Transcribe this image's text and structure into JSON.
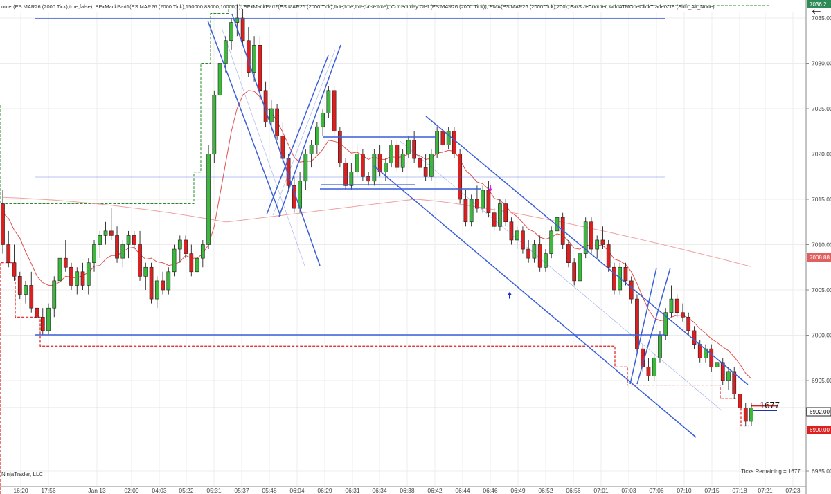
{
  "header": {
    "indicators": "unter(ES MAR26 (2000 Tick),true,false), BPxMackPart1(ES MAR26 (2000 Tick),150000,83000,10000,1), BPxMackPart2(ES MAR26 (2000 Tick),true,true,true,false,true), Current day OHL(ES MAR26 (2000 Tick)), EMA(ES MAR26 (2000 Tick),200), BarSizeCounter, wdoATMOneClickTraderV19 (Shift_Alt_None)"
  },
  "footer": {
    "copyright": "NinjaTrader, LLC",
    "ticks_remaining": "Ticks Remaining = 1677"
  },
  "counter": {
    "value": "1677"
  },
  "price_tags": {
    "top": "7036.2",
    "ema": "7008.88",
    "last": "6992.00",
    "low": "6990.00"
  },
  "colors": {
    "up": "#3cb83c",
    "down": "#dd1f1f",
    "channel": "#3a5fd8",
    "ema_fast": "#e05050",
    "ema_slow": "#f0a0a0",
    "level_red": "#dd1f1f",
    "level_green": "#2a8a2a"
  },
  "icons": {
    "back": "←"
  },
  "chart_data": {
    "type": "candlestick",
    "instrument": "ES MAR26 (2000 Tick)",
    "ylim": [
      6985.0,
      7037.0
    ],
    "y_ticks": [
      6985.0,
      6990.0,
      6995.0,
      7000.0,
      7005.0,
      7010.0,
      7015.0,
      7020.0,
      7025.0,
      7030.0,
      7035.0
    ],
    "x_labels": [
      "16:20",
      "17:56",
      "Jan 13",
      "02:09",
      "04:03",
      "05:22",
      "05:31",
      "05:37",
      "05:48",
      "06:04",
      "06:29",
      "06:31",
      "06:34",
      "06:38",
      "06:42",
      "06:44",
      "06:46",
      "06:49",
      "06:52",
      "06:56",
      "07:01",
      "07:03",
      "07:06",
      "07:10",
      "07:15",
      "07:18",
      "07:21",
      "07:23"
    ],
    "candles": [
      [
        7014.5,
        7016.0,
        7009.0,
        7010.0
      ],
      [
        7010.0,
        7011.5,
        7007.5,
        7008.0
      ],
      [
        7008.0,
        7010.0,
        7006.0,
        7006.5
      ],
      [
        7006.5,
        7007.0,
        7004.0,
        7004.5
      ],
      [
        7004.5,
        7006.0,
        7003.5,
        7005.5
      ],
      [
        7005.5,
        7007.0,
        7002.5,
        7003.0
      ],
      [
        7003.0,
        7004.0,
        7001.5,
        7002.0
      ],
      [
        7002.0,
        7003.0,
        7000.0,
        7000.5
      ],
      [
        7000.5,
        7003.5,
        7000.0,
        7003.0
      ],
      [
        7003.0,
        7006.5,
        7002.0,
        7006.0
      ],
      [
        7006.0,
        7009.0,
        7005.5,
        7008.5
      ],
      [
        7008.5,
        7010.5,
        7007.0,
        7007.5
      ],
      [
        7007.5,
        7008.0,
        7005.0,
        7005.5
      ],
      [
        7005.5,
        7007.5,
        7004.5,
        7007.0
      ],
      [
        7007.0,
        7008.0,
        7005.0,
        7005.5
      ],
      [
        7005.5,
        7008.5,
        7004.5,
        7008.0
      ],
      [
        7008.0,
        7010.5,
        7007.0,
        7010.0
      ],
      [
        7010.0,
        7011.5,
        7008.5,
        7011.0
      ],
      [
        7011.0,
        7012.5,
        7010.0,
        7011.5
      ],
      [
        7011.5,
        7014.0,
        7010.5,
        7011.0
      ],
      [
        7011.0,
        7012.0,
        7008.0,
        7008.5
      ],
      [
        7008.5,
        7010.5,
        7007.5,
        7010.0
      ],
      [
        7010.0,
        7011.5,
        7008.5,
        7011.0
      ],
      [
        7011.0,
        7011.5,
        7009.5,
        7010.0
      ],
      [
        7010.0,
        7011.5,
        7006.0,
        7006.5
      ],
      [
        7006.5,
        7008.0,
        7005.0,
        7007.5
      ],
      [
        7007.5,
        7008.0,
        7003.5,
        7004.0
      ],
      [
        7004.0,
        7006.5,
        7003.0,
        7006.0
      ],
      [
        7006.0,
        7007.0,
        7004.5,
        7005.0
      ],
      [
        7005.0,
        7007.5,
        7004.5,
        7007.0
      ],
      [
        7007.0,
        7010.0,
        7006.5,
        7009.5
      ],
      [
        7009.5,
        7011.0,
        7008.0,
        7010.5
      ],
      [
        7010.5,
        7011.0,
        7008.5,
        7009.0
      ],
      [
        7009.0,
        7010.0,
        7006.5,
        7007.0
      ],
      [
        7007.0,
        7009.0,
        7006.0,
        7008.5
      ],
      [
        7008.5,
        7010.5,
        7007.5,
        7010.0
      ],
      [
        7010.0,
        7021.0,
        7009.5,
        7020.0
      ],
      [
        7020.0,
        7027.0,
        7019.0,
        7026.5
      ],
      [
        7026.5,
        7030.5,
        7025.5,
        7030.0
      ],
      [
        7030.0,
        7033.0,
        7029.0,
        7032.5
      ],
      [
        7032.5,
        7035.0,
        7031.5,
        7034.5
      ],
      [
        7034.5,
        7036.5,
        7033.0,
        7035.0
      ],
      [
        7035.0,
        7036.0,
        7032.0,
        7032.5
      ],
      [
        7032.5,
        7034.0,
        7028.5,
        7029.0
      ],
      [
        7029.0,
        7033.0,
        7028.0,
        7032.0
      ],
      [
        7032.0,
        7033.0,
        7026.0,
        7027.0
      ],
      [
        7027.0,
        7028.0,
        7023.0,
        7023.5
      ],
      [
        7023.5,
        7026.0,
        7022.5,
        7025.0
      ],
      [
        7025.0,
        7025.5,
        7021.5,
        7022.0
      ],
      [
        7022.0,
        7023.5,
        7019.0,
        7019.5
      ],
      [
        7019.5,
        7020.0,
        7016.0,
        7016.5
      ],
      [
        7016.5,
        7017.5,
        7013.5,
        7014.0
      ],
      [
        7014.0,
        7018.0,
        7013.5,
        7017.0
      ],
      [
        7017.0,
        7020.5,
        7016.0,
        7020.0
      ],
      [
        7020.0,
        7021.5,
        7018.5,
        7021.0
      ],
      [
        7021.0,
        7023.5,
        7020.0,
        7023.0
      ],
      [
        7023.0,
        7025.0,
        7022.0,
        7024.5
      ],
      [
        7024.5,
        7027.5,
        7024.0,
        7027.0
      ],
      [
        7027.0,
        7027.5,
        7022.0,
        7022.5
      ],
      [
        7022.5,
        7023.0,
        7018.5,
        7019.0
      ],
      [
        7019.0,
        7019.5,
        7016.0,
        7016.5
      ],
      [
        7016.5,
        7019.0,
        7016.0,
        7018.0
      ],
      [
        7018.0,
        7021.0,
        7017.5,
        7020.0
      ],
      [
        7020.0,
        7020.5,
        7017.0,
        7017.5
      ],
      [
        7017.5,
        7018.0,
        7016.5,
        7017.0
      ],
      [
        7017.0,
        7020.5,
        7016.5,
        7020.0
      ],
      [
        7020.0,
        7021.0,
        7017.5,
        7018.0
      ],
      [
        7018.0,
        7019.5,
        7017.0,
        7019.0
      ],
      [
        7019.0,
        7021.5,
        7018.5,
        7021.0
      ],
      [
        7021.0,
        7021.5,
        7018.0,
        7018.5
      ],
      [
        7018.5,
        7020.5,
        7018.0,
        7020.0
      ],
      [
        7020.0,
        7022.0,
        7019.5,
        7021.5
      ],
      [
        7021.5,
        7022.5,
        7019.0,
        7019.5
      ],
      [
        7019.5,
        7020.0,
        7018.0,
        7018.5
      ],
      [
        7018.5,
        7020.0,
        7017.0,
        7017.5
      ],
      [
        7017.5,
        7020.5,
        7017.0,
        7020.0
      ],
      [
        7020.0,
        7023.0,
        7019.5,
        7022.5
      ],
      [
        7022.5,
        7023.0,
        7020.0,
        7021.0
      ],
      [
        7021.0,
        7023.0,
        7020.5,
        7022.5
      ],
      [
        7022.5,
        7023.0,
        7019.5,
        7020.0
      ],
      [
        7020.0,
        7020.5,
        7014.5,
        7015.0
      ],
      [
        7015.0,
        7016.0,
        7012.0,
        7012.5
      ],
      [
        7012.5,
        7015.5,
        7012.0,
        7015.0
      ],
      [
        7015.0,
        7016.5,
        7013.5,
        7014.0
      ],
      [
        7014.0,
        7016.5,
        7013.5,
        7016.0
      ],
      [
        7016.0,
        7017.0,
        7013.0,
        7013.5
      ],
      [
        7013.5,
        7014.0,
        7011.5,
        7012.0
      ],
      [
        7012.0,
        7015.0,
        7011.5,
        7014.5
      ],
      [
        7014.5,
        7015.0,
        7012.0,
        7012.5
      ],
      [
        7012.5,
        7013.0,
        7010.0,
        7010.5
      ],
      [
        7010.5,
        7012.0,
        7009.5,
        7011.5
      ],
      [
        7011.5,
        7012.0,
        7009.0,
        7009.5
      ],
      [
        7009.5,
        7010.5,
        7008.0,
        7008.5
      ],
      [
        7008.5,
        7010.5,
        7008.0,
        7010.0
      ],
      [
        7010.0,
        7011.0,
        7007.0,
        7007.5
      ],
      [
        7007.5,
        7009.5,
        7007.0,
        7009.0
      ],
      [
        7009.0,
        7012.0,
        7008.5,
        7011.5
      ],
      [
        7011.5,
        7014.0,
        7011.0,
        7013.0
      ],
      [
        7013.0,
        7013.5,
        7009.5,
        7010.0
      ],
      [
        7010.0,
        7010.5,
        7007.5,
        7008.0
      ],
      [
        7008.0,
        7008.5,
        7005.5,
        7006.0
      ],
      [
        7006.0,
        7009.5,
        7005.5,
        7009.0
      ],
      [
        7009.0,
        7013.0,
        7008.5,
        7012.5
      ],
      [
        7012.5,
        7013.0,
        7009.0,
        7009.5
      ],
      [
        7009.5,
        7011.0,
        7008.5,
        7010.5
      ],
      [
        7010.5,
        7012.0,
        7009.5,
        7010.0
      ],
      [
        7010.0,
        7010.5,
        7007.0,
        7007.5
      ],
      [
        7007.5,
        7008.0,
        7004.5,
        7005.0
      ],
      [
        7005.0,
        7008.0,
        7004.5,
        7007.5
      ],
      [
        7007.5,
        7008.0,
        7005.5,
        7006.0
      ],
      [
        7006.0,
        7006.5,
        7003.5,
        7004.0
      ],
      [
        7004.0,
        7004.5,
        6998.0,
        6998.5
      ],
      [
        6998.5,
        6999.0,
        6996.0,
        6996.5
      ],
      [
        6996.5,
        6997.5,
        6995.0,
        6995.5
      ],
      [
        6995.5,
        6998.0,
        6995.0,
        6997.5
      ],
      [
        6997.5,
        7000.5,
        6997.0,
        7000.0
      ],
      [
        7000.0,
        7003.0,
        6999.5,
        7002.5
      ],
      [
        7002.5,
        7005.5,
        7002.0,
        7004.0
      ],
      [
        7004.0,
        7004.5,
        7002.0,
        7002.5
      ],
      [
        7002.5,
        7003.5,
        7001.5,
        7002.0
      ],
      [
        7002.0,
        7002.5,
        7000.0,
        7000.5
      ],
      [
        7000.5,
        7001.0,
        6998.5,
        6999.0
      ],
      [
        6999.0,
        6999.5,
        6997.0,
        6997.5
      ],
      [
        6997.5,
        6999.0,
        6997.0,
        6998.5
      ],
      [
        6998.5,
        6999.0,
        6996.0,
        6996.5
      ],
      [
        6996.5,
        6997.5,
        6995.5,
        6997.0
      ],
      [
        6997.0,
        6997.5,
        6994.5,
        6995.0
      ],
      [
        6995.0,
        6996.5,
        6994.0,
        6996.0
      ],
      [
        6996.0,
        6996.5,
        6993.0,
        6993.5
      ],
      [
        6993.5,
        6994.0,
        6991.5,
        6992.0
      ],
      [
        6992.0,
        6992.5,
        6990.0,
        6990.5
      ],
      [
        6990.5,
        6992.5,
        6990.0,
        6992.0
      ]
    ],
    "ema_fast_values": [
      7013.5,
      7012.9,
      7011.6,
      7010.7,
      7009.2,
      7007.9,
      7006.5,
      7005.8,
      7005.5,
      7005.5,
      7005.9,
      7006.5,
      7006.4,
      7006.3,
      7006.6,
      7006.9,
      7007.6,
      7007.7,
      7008.4,
      7008.8,
      7008.8,
      7009.2,
      7009.6,
      7009.7,
      7008.9,
      7008.4,
      7008.5,
      7008.1,
      7008.0,
      7007.7,
      7007.8,
      7008.1,
      7008.8,
      7008.5,
      7008.5,
      7009.0,
      7010.0,
      7012.0,
      7015.5,
      7019.0,
      7022.5,
      7025.0,
      7026.5,
      7027.0,
      7026.9,
      7026.3,
      7025.2,
      7024.6,
      7023.6,
      7022.4,
      7021.0,
      7019.6,
      7019.1,
      7019.2,
      7019.2,
      7019.8,
      7020.5,
      7021.5,
      7021.4,
      7021.2,
      7020.6,
      7020.1,
      7020.2,
      7019.8,
      7019.4,
      7019.7,
      7019.4,
      7019.4,
      7019.7,
      7019.6,
      7019.7,
      7020.0,
      7020.0,
      7019.8,
      7019.4,
      7019.5,
      7020.1,
      7020.2,
      7020.4,
      7020.3,
      7019.4,
      7018.2,
      7017.6,
      7016.9,
      7016.7,
      7016.1,
      7015.1,
      7014.9,
      7014.3,
      7013.5,
      7013.1,
      7012.4,
      7011.7,
      7011.4,
      7010.8,
      7010.6,
      7010.8,
      7011.2,
      7011.0,
      7010.4,
      7009.6,
      7009.5,
      7010.0,
      7009.8,
      7009.9,
      7009.9,
      7009.3,
      7008.4,
      7008.2,
      7007.8,
      7007.0,
      7005.7,
      7004.2,
      7002.8,
      7001.9,
      7001.6,
      7001.7,
      7002.0,
      7002.2,
      7002.2,
      7001.9,
      7001.4,
      7000.7,
      7000.2,
      6999.6,
      6999.2,
      6998.7,
      6998.3,
      6997.6,
      6996.8,
      6995.8,
      6995.2
    ]
  }
}
